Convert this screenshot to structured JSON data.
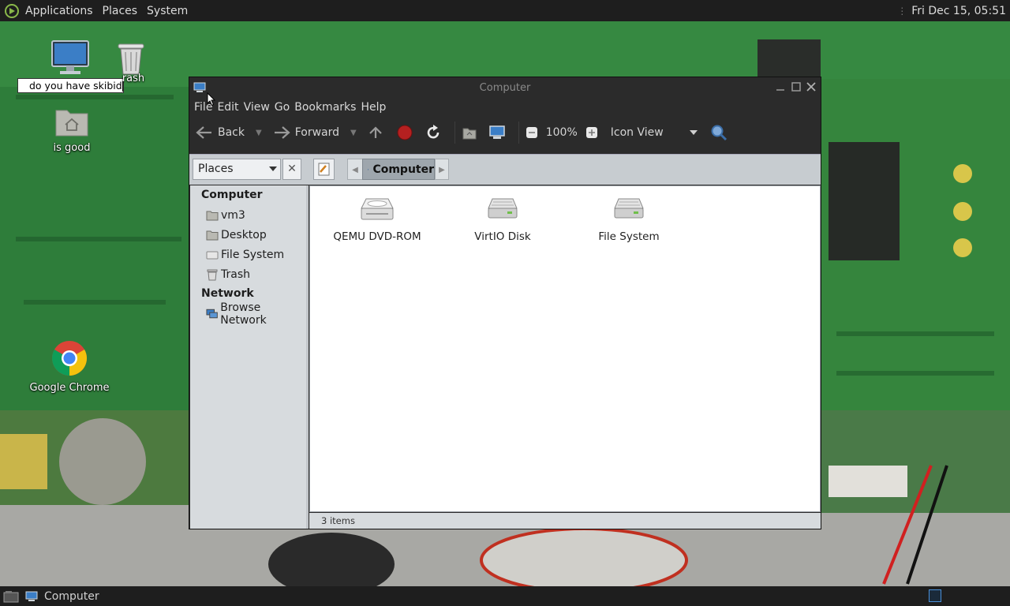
{
  "top_panel": {
    "menus": [
      "Applications",
      "Places",
      "System"
    ],
    "clock": "Fri Dec 15, 05:51"
  },
  "desktop": {
    "rename_text": "do you have skibid",
    "trash_label_partial": "rash",
    "home_folder_label": "is good",
    "chrome_label": "Google Chrome"
  },
  "window": {
    "title": "Computer",
    "menu": [
      "File",
      "Edit",
      "View",
      "Go",
      "Bookmarks",
      "Help"
    ],
    "toolbar": {
      "back": "Back",
      "forward": "Forward",
      "zoom": "100%",
      "view_mode": "Icon View"
    },
    "location": {
      "places_combo": "Places",
      "breadcrumb": "Computer"
    },
    "sidebar": {
      "sections": [
        {
          "title": "Computer",
          "items": [
            "vm3",
            "Desktop",
            "File System",
            "Trash"
          ]
        },
        {
          "title": "Network",
          "items": [
            "Browse Network"
          ]
        }
      ]
    },
    "files": [
      "QEMU DVD-ROM",
      "VirtIO Disk",
      "File System"
    ],
    "status": "3 items"
  },
  "bottom_panel": {
    "task_label": "Computer"
  }
}
